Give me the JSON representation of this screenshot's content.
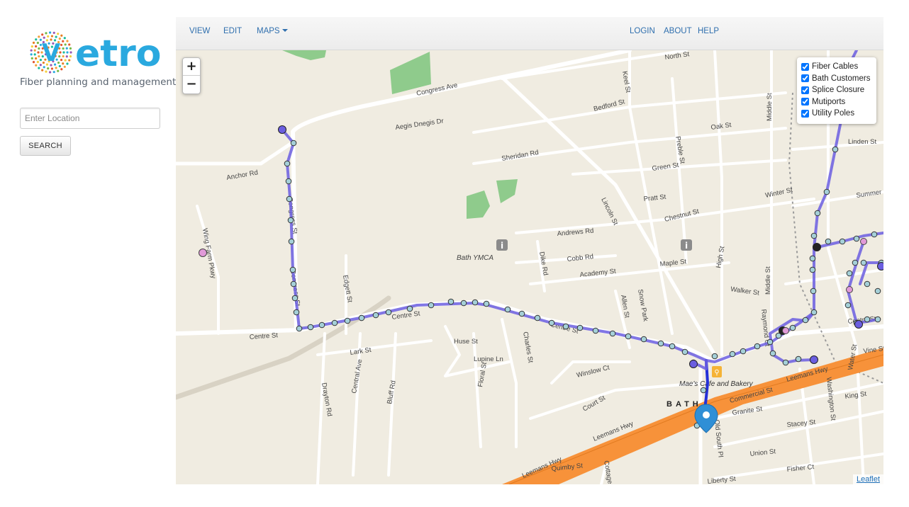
{
  "app": {
    "logo_word": "etro",
    "logo_letter": "V",
    "tagline": "Fiber planning and management"
  },
  "search": {
    "placeholder": "Enter Location",
    "button_label": "SEARCH"
  },
  "navbar": {
    "left": [
      {
        "label": "VIEW"
      },
      {
        "label": "EDIT"
      },
      {
        "label": "MAPS"
      }
    ],
    "right": [
      {
        "label": "LOGIN"
      },
      {
        "label": "ABOUT"
      },
      {
        "label": "HELP"
      }
    ]
  },
  "map": {
    "zoom_in": "+",
    "zoom_out": "−",
    "attribution": "Leaflet",
    "layers": [
      {
        "label": "Fiber Cables",
        "checked": true
      },
      {
        "label": "Bath Customers",
        "checked": true
      },
      {
        "label": "Splice Closure",
        "checked": true
      },
      {
        "label": "Mutiports",
        "checked": true
      },
      {
        "label": "Utility Poles",
        "checked": true
      }
    ],
    "street_labels": {
      "congress_ave": "Congress Ave",
      "aegis": "Aegis Dnegis Dr",
      "anchor": "Anchor Rd",
      "sheridan": "Sheridan Rd",
      "bedford": "Bedford St",
      "oak": "Oak St",
      "keel": "Keel St",
      "north": "North St",
      "green": "Green St",
      "preble": "Preble St",
      "pratt": "Pratt St",
      "chestnut": "Chestnut St",
      "winter": "Winter St",
      "lincoln": "Lincoln St",
      "andrews": "Andrews Rd",
      "cobb": "Cobb Rd",
      "academy": "Academy St",
      "maple": "Maple St",
      "dike": "Dike Rd",
      "centre": "Centre St",
      "lark": "Lark St",
      "huse": "Huse St",
      "lupine": "Lupine Ln",
      "charles": "Charles St",
      "edgett": "Edgett St",
      "walker": "Walker St",
      "high": "High St",
      "middle": "Middle St",
      "linden": "Linden St",
      "wing_farm": "Wing Farm Pkwy",
      "winslow": "Winslow Ct",
      "court": "Court St",
      "drayton": "Drayton Rd",
      "central": "Central Ave",
      "bluff": "Bluff Rd",
      "floral": "Floral St",
      "leemans_hwy": "Leemans Hwy",
      "commercial": "Commercial St",
      "granite": "Granite St",
      "stacey": "Stacey St",
      "union": "Union St",
      "fisher": "Fisher Ct",
      "liberty": "Liberty St",
      "quimby": "Quimby St",
      "cottage": "Cottage St",
      "king": "King St",
      "washington": "Washington St",
      "water": "Water St",
      "vine": "Vine St",
      "old_south": "Old South Pl",
      "raymond": "Raymond Ct",
      "snow": "Snow Park",
      "allen": "Allen St",
      "summer": "Summer St",
      "congress_st": "Congress St"
    },
    "poi": {
      "ymca": "Bath YMCA",
      "cafe": "Mae's Cafe and Bakery",
      "town": "BATH"
    },
    "colors": {
      "land": "#f0ece1",
      "road": "#ffffff",
      "park": "#8fcb8c",
      "highway": "#f7923a",
      "fiber": "#6b5ee0",
      "pole": "#a5d0d8",
      "customer": "#e19ad8",
      "marker": "#2f8fd6"
    }
  }
}
